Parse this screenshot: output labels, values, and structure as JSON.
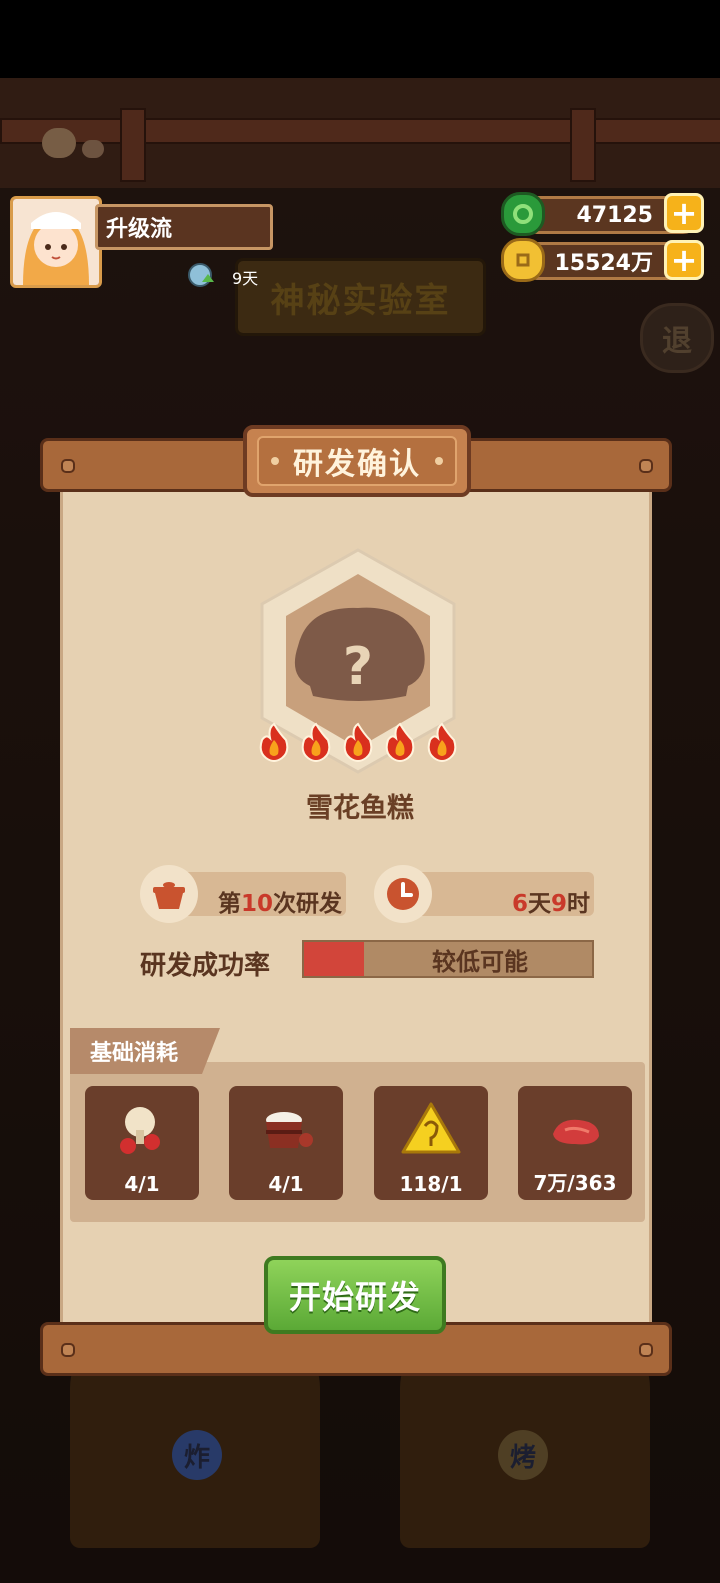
{
  "scene": {
    "lab_sign": "神秘实验室",
    "exit_label": "退",
    "stove_badges": [
      "炸",
      "烤"
    ]
  },
  "player": {
    "name": "升级流",
    "days": "9天"
  },
  "resources": {
    "jade": "47125",
    "coins": "15524万"
  },
  "dialog": {
    "title": "研发确认",
    "dish_name": "雪花鱼糕",
    "unknown_mark": "?",
    "difficulty_flames": 5,
    "attempt_prefix": "第",
    "attempt_number": "10",
    "attempt_suffix": "次研发",
    "time_days": "6",
    "time_days_unit": "天",
    "time_hours": "9",
    "time_hours_unit": "时",
    "success_rate_label": "研发成功率",
    "success_rate_text": "较低可能",
    "success_rate_fraction": 0.21,
    "consumption_title": "基础消耗",
    "items": [
      {
        "icon": "drumstick-pepper-icon",
        "amount": "4/1"
      },
      {
        "icon": "rice-bowl-icon",
        "amount": "4/1"
      },
      {
        "icon": "golden-triangle-charm-icon",
        "amount": "118/1"
      },
      {
        "icon": "raw-meat-icon",
        "amount": "7万/363"
      }
    ],
    "start_button": "开始研发"
  },
  "colors": {
    "accent_red": "#c9392a",
    "button_green": "#5ba936",
    "gold": "#f6b21a"
  }
}
